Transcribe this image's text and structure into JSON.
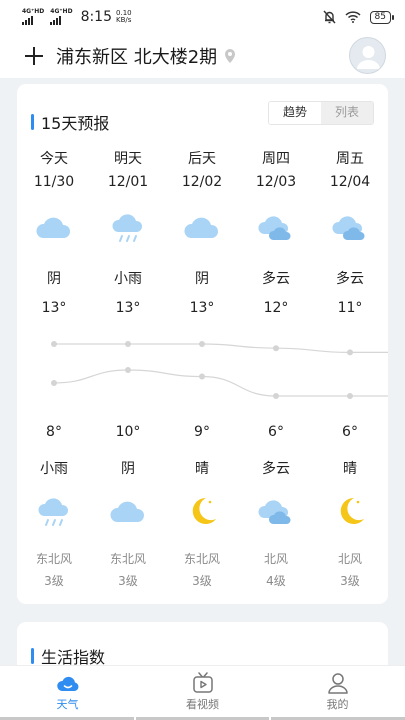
{
  "status_bar": {
    "network1": "4G⁺HD",
    "network2": "4G⁺HD",
    "time": "8:15",
    "speed_value": "0.10",
    "speed_unit": "KB/s",
    "battery": "85"
  },
  "header": {
    "location": "浦东新区 北大楼2期"
  },
  "forecast": {
    "title": "15天预报",
    "toggle": [
      "趋势",
      "列表"
    ],
    "days": [
      {
        "label": "今天",
        "date": "11/30",
        "day_weather": "阴",
        "high": "13°",
        "low": "8°",
        "night_weather": "小雨",
        "wind_dir": "东北风",
        "wind_level": "3级",
        "day_icon": "cloudy-icon",
        "night_icon": "rain-icon"
      },
      {
        "label": "明天",
        "date": "12/01",
        "day_weather": "小雨",
        "high": "13°",
        "low": "10°",
        "night_weather": "阴",
        "wind_dir": "东北风",
        "wind_level": "3级",
        "day_icon": "rain-icon",
        "night_icon": "cloudy-icon"
      },
      {
        "label": "后天",
        "date": "12/02",
        "day_weather": "阴",
        "high": "13°",
        "low": "9°",
        "night_weather": "晴",
        "wind_dir": "东北风",
        "wind_level": "3级",
        "day_icon": "cloudy-icon",
        "night_icon": "moon-icon"
      },
      {
        "label": "周四",
        "date": "12/03",
        "day_weather": "多云",
        "high": "12°",
        "low": "6°",
        "night_weather": "多云",
        "wind_dir": "北风",
        "wind_level": "4级",
        "day_icon": "partly-cloudy-icon",
        "night_icon": "partly-cloudy-icon"
      },
      {
        "label": "周五",
        "date": "12/04",
        "day_weather": "多云",
        "high": "11°",
        "low": "6°",
        "night_weather": "晴",
        "wind_dir": "北风",
        "wind_level": "3级",
        "day_icon": "partly-cloudy-icon",
        "night_icon": "moon-icon"
      }
    ]
  },
  "life": {
    "title": "生活指数"
  },
  "nav": {
    "items": [
      {
        "label": "天气",
        "icon": "weather-icon",
        "active": true
      },
      {
        "label": "看视频",
        "icon": "video-icon",
        "active": false
      },
      {
        "label": "我的",
        "icon": "profile-icon",
        "active": false
      }
    ]
  },
  "colors": {
    "accent": "#2f8cf0",
    "cloud": "#a9d4f5",
    "moon": "#f5c518"
  }
}
